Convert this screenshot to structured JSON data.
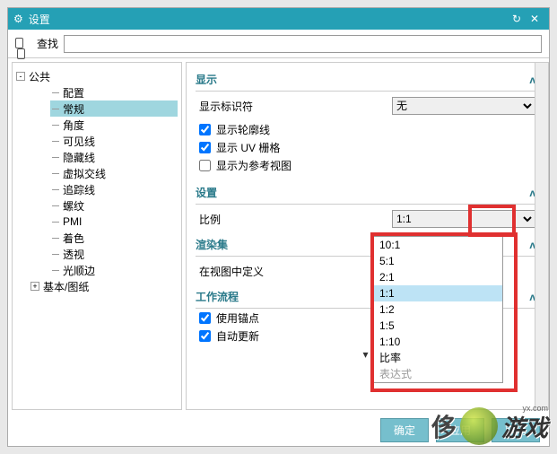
{
  "titlebar": {
    "title": "设置"
  },
  "search": {
    "label": "查找",
    "value": ""
  },
  "tree": {
    "root1": {
      "label": "公共",
      "expander": "-"
    },
    "items": [
      "配置",
      "常规",
      "角度",
      "可见线",
      "隐藏线",
      "虚拟交线",
      "追踪线",
      "螺纹",
      "PMI",
      "着色",
      "透视",
      "光顺边"
    ],
    "selectedIndex": 1,
    "root2": {
      "label": "基本/图纸",
      "expander": "+"
    }
  },
  "sections": {
    "display": {
      "title": "显示",
      "marker_label": "显示标识符",
      "marker_value": "无",
      "checks": [
        {
          "label": "显示轮廓线",
          "checked": true
        },
        {
          "label": "显示 UV 栅格",
          "checked": true
        },
        {
          "label": "显示为参考视图",
          "checked": false
        }
      ]
    },
    "settings": {
      "title": "设置",
      "scale_label": "比例",
      "scale_value": "1:1"
    },
    "renderset": {
      "title": "渲染集",
      "define_label": "在视图中定义"
    },
    "workflow": {
      "title": "工作流程",
      "checks": [
        {
          "label": "使用锚点",
          "checked": true
        },
        {
          "label": "自动更新",
          "checked": true
        }
      ]
    }
  },
  "dropdown": {
    "options": [
      "10:1",
      "5:1",
      "2:1",
      "1:1",
      "1:2",
      "1:5",
      "1:10",
      "比率",
      "表达式"
    ],
    "highlight": 3,
    "disabled": 8
  },
  "footer": {
    "ok": "确定",
    "apply": "应用",
    "cancel": "取消"
  },
  "watermark": {
    "text": "游戏",
    "sub": "yx.com"
  }
}
